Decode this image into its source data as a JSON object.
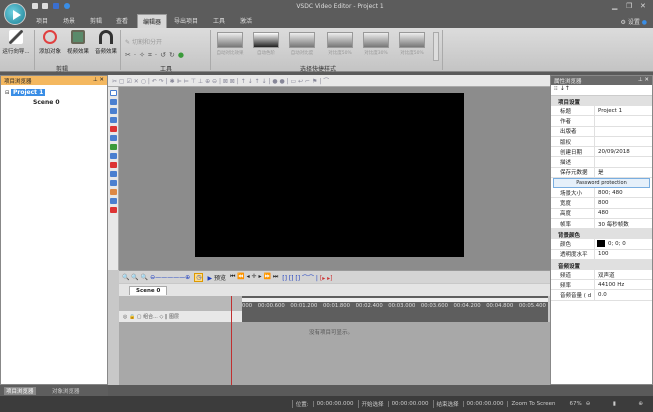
{
  "window": {
    "title": "VSDC Video Editor - Project 1",
    "minimize": "▁",
    "restore": "❐",
    "close": "✕"
  },
  "menu_tabs": [
    "项目",
    "场景",
    "剪辑",
    "查看",
    "编辑器",
    "导出项目",
    "工具",
    "激活"
  ],
  "active_tab": "编辑器",
  "settings_label": "设置",
  "ribbon": {
    "buttons": [
      "运行向导...",
      "添加对象",
      "视频效果",
      "音频效果"
    ],
    "group_edit": "剪辑",
    "cut_split": "切割和分开",
    "group_tools": "工具",
    "gallery_captions": [
      "自动对比效果",
      "自动色阶",
      "自动对比度",
      "对比度50%",
      "对比度30%",
      "对比度50%"
    ],
    "group_styles": "选择快捷样式"
  },
  "project_explorer": {
    "title": "项目浏览器",
    "project": "Project 1",
    "scene": "Scene 0"
  },
  "bottom_tabs": [
    "项目浏览器",
    "对象浏览器"
  ],
  "timeline": {
    "preview_label": "预览",
    "scene_tab": "Scene 0",
    "track_header": "组合...",
    "layer_label": "图层",
    "ticks": [
      "000",
      "00:00.600",
      "00:01.200",
      "00:01.800",
      "00:02.400",
      "00:03.000",
      "00:03.600",
      "00:04.200",
      "00:04.800",
      "00:05.400"
    ],
    "empty_message": "没有项目可显示。"
  },
  "properties": {
    "title": "属性浏览器",
    "section_project": "项目设置",
    "rows_a": [
      [
        "标题",
        "Project 1"
      ],
      [
        "作者",
        ""
      ],
      [
        "出版者",
        ""
      ],
      [
        "版权",
        ""
      ],
      [
        "创建日期",
        "20/09/2018"
      ],
      [
        "描述",
        ""
      ],
      [
        "保存元数据",
        "是"
      ]
    ],
    "password_button": "Password protection",
    "rows_b": [
      [
        "场景大小",
        "800; 480"
      ],
      [
        "宽度",
        "800"
      ],
      [
        "高度",
        "480"
      ],
      [
        "帧率",
        "30 每秒帧数"
      ]
    ],
    "section_bg": "背景颜色",
    "rows_c": [
      [
        "颜色",
        "0; 0; 0"
      ],
      [
        "透明度水平",
        "100"
      ]
    ],
    "section_audio": "音频设置",
    "rows_d": [
      [
        "频道",
        "双声道"
      ],
      [
        "频率",
        "44100 Hz"
      ],
      [
        "音频音量 ( d",
        "0.0"
      ]
    ]
  },
  "status": {
    "position_label": "位置:",
    "position": "00:00:00.000",
    "start_label": "开始选择",
    "start": "00:00:00.000",
    "end_label": "结束选择",
    "end": "00:00:00.000",
    "zoom_label": "Zoom To Screen",
    "zoom": "67%"
  }
}
